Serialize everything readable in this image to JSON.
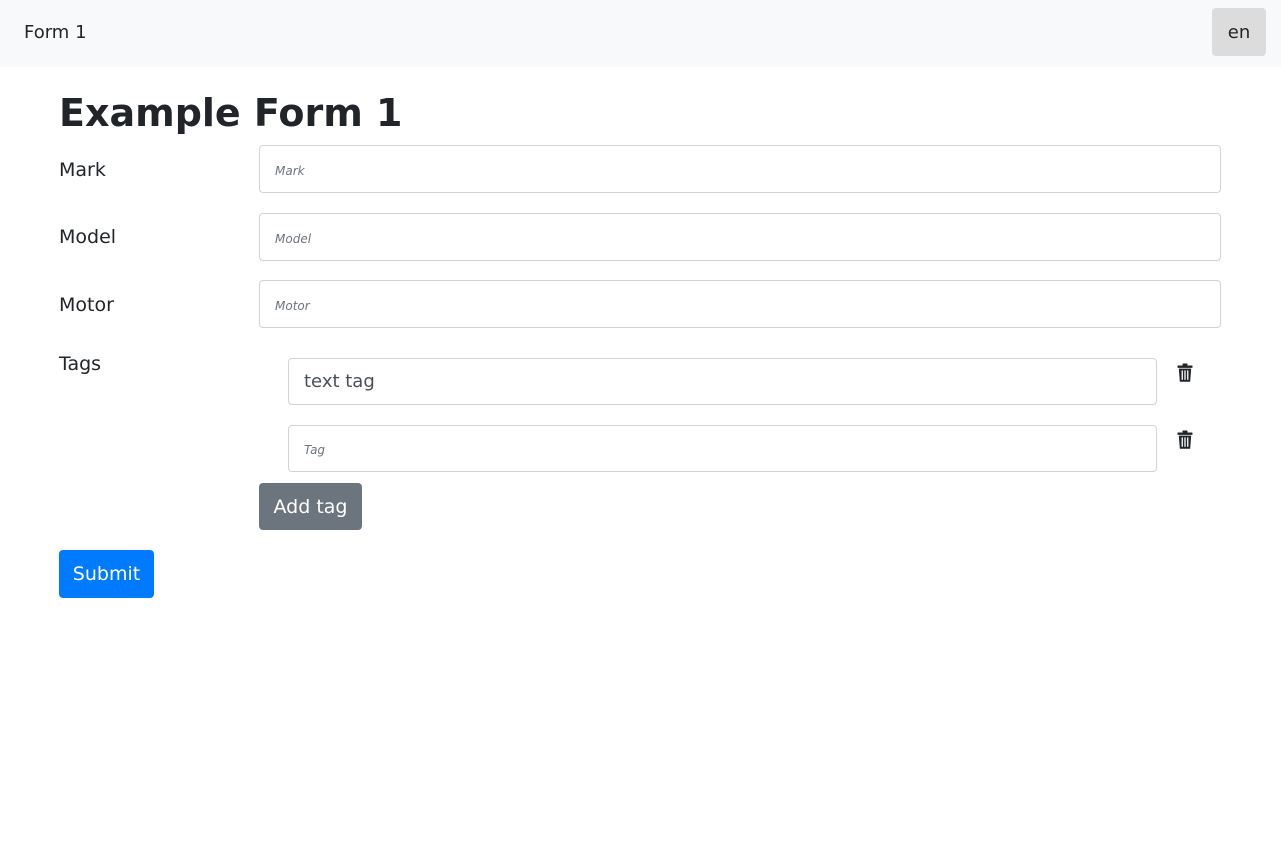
{
  "navbar": {
    "brand": "Form 1",
    "language": "en"
  },
  "form": {
    "title": "Example Form 1",
    "fields": {
      "mark": {
        "label": "Mark",
        "placeholder": "Mark",
        "value": ""
      },
      "model": {
        "label": "Model",
        "placeholder": "Model",
        "value": ""
      },
      "motor": {
        "label": "Motor",
        "placeholder": "Motor",
        "value": ""
      }
    },
    "tags": {
      "label": "Tags",
      "items": [
        {
          "value": "text tag",
          "placeholder": "Tag"
        },
        {
          "value": "",
          "placeholder": "Tag"
        }
      ],
      "add_label": "Add tag"
    },
    "submit_label": "Submit"
  },
  "icons": {
    "delete": "trash-icon"
  },
  "colors": {
    "primary": "#007bff",
    "secondary": "#6c757d",
    "navbar_bg": "#f8f9fa",
    "language_button_bg": "#dcdcdc"
  }
}
